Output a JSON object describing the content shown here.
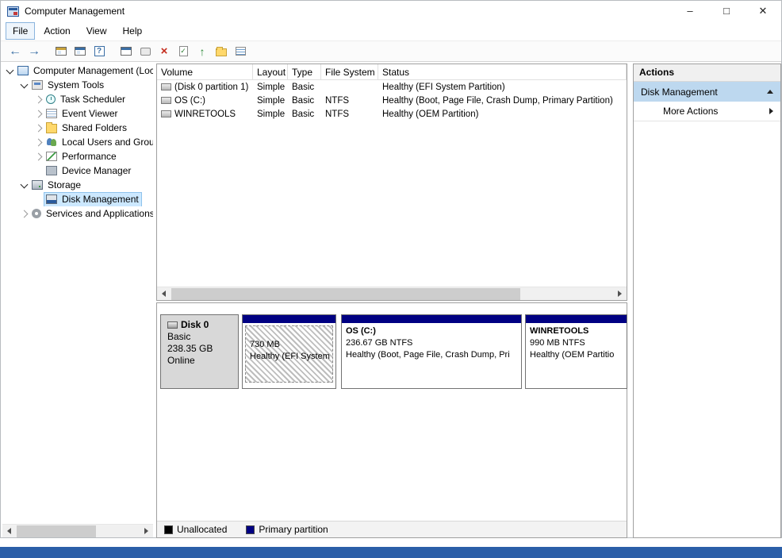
{
  "window": {
    "title": "Computer Management",
    "minimize_glyph": "–",
    "maximize_glyph": "□",
    "close_glyph": "✕"
  },
  "menu": {
    "items": [
      "File",
      "Action",
      "View",
      "Help"
    ]
  },
  "toolbar": {
    "icons": [
      {
        "name": "back",
        "glyph": "←"
      },
      {
        "name": "forward",
        "glyph": "→"
      },
      {
        "name": "show-console-tree",
        "glyph": ""
      },
      {
        "name": "console-window",
        "glyph": ""
      },
      {
        "name": "help",
        "glyph": "?"
      },
      {
        "name": "properties-window",
        "glyph": ""
      },
      {
        "name": "dialog",
        "glyph": ""
      },
      {
        "name": "delete",
        "glyph": "×"
      },
      {
        "name": "properties-check",
        "glyph": "✓"
      },
      {
        "name": "up-arrow",
        "glyph": "↑"
      },
      {
        "name": "open-folder",
        "glyph": ""
      },
      {
        "name": "view-list",
        "glyph": ""
      }
    ]
  },
  "tree": {
    "items": [
      {
        "label": "Computer Management (Local",
        "level": 0,
        "state": "expanded"
      },
      {
        "label": "System Tools",
        "level": 1,
        "state": "expanded"
      },
      {
        "label": "Task Scheduler",
        "level": 2,
        "state": "collapsed"
      },
      {
        "label": "Event Viewer",
        "level": 2,
        "state": "collapsed"
      },
      {
        "label": "Shared Folders",
        "level": 2,
        "state": "collapsed"
      },
      {
        "label": "Local Users and Groups",
        "level": 2,
        "state": "collapsed"
      },
      {
        "label": "Performance",
        "level": 2,
        "state": "collapsed"
      },
      {
        "label": "Device Manager",
        "level": 2,
        "state": "none"
      },
      {
        "label": "Storage",
        "level": 1,
        "state": "expanded"
      },
      {
        "label": "Disk Management",
        "level": 2,
        "state": "none",
        "selected": true
      },
      {
        "label": "Services and Applications",
        "level": 1,
        "state": "collapsed"
      }
    ]
  },
  "volume_table": {
    "columns": [
      "Volume",
      "Layout",
      "Type",
      "File System",
      "Status"
    ],
    "rows": [
      {
        "cells": [
          "(Disk 0 partition 1)",
          "Simple",
          "Basic",
          "",
          "Healthy (EFI System Partition)"
        ]
      },
      {
        "cells": [
          "OS (C:)",
          "Simple",
          "Basic",
          "NTFS",
          "Healthy (Boot, Page File, Crash Dump, Primary Partition)"
        ]
      },
      {
        "cells": [
          "WINRETOOLS",
          "Simple",
          "Basic",
          "NTFS",
          "Healthy (OEM Partition)"
        ]
      }
    ]
  },
  "disk_view": {
    "disk": {
      "label": "Disk 0",
      "type": "Basic",
      "size": "238.35 GB",
      "status": "Online"
    },
    "partitions": [
      {
        "name": "",
        "size": "730 MB",
        "status": "Healthy (EFI System"
      },
      {
        "name": "OS  (C:)",
        "size": "236.67 GB NTFS",
        "status": "Healthy (Boot, Page File, Crash Dump, Pri"
      },
      {
        "name": "WINRETOOLS",
        "size": "990 MB NTFS",
        "status": "Healthy (OEM Partitio"
      }
    ]
  },
  "legend": {
    "items": [
      {
        "label": "Unallocated",
        "color": "#000000"
      },
      {
        "label": "Primary partition",
        "color": "#000082"
      }
    ]
  },
  "actions": {
    "title": "Actions",
    "items": [
      {
        "label": "Disk Management"
      },
      {
        "label": "More Actions"
      }
    ]
  }
}
